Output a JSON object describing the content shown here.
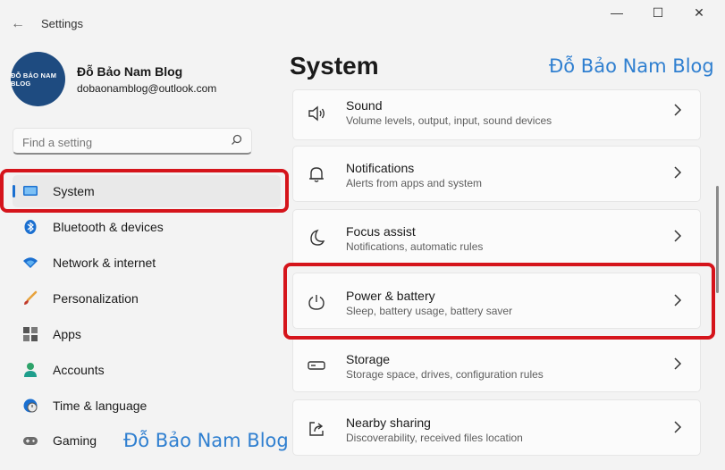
{
  "window": {
    "title": "Settings",
    "back_glyph": "←",
    "min_glyph": "—",
    "max_glyph": "☐",
    "close_glyph": "✕"
  },
  "profile": {
    "name": "Đỗ Bảo Nam Blog",
    "email": "dobaonamblog@outlook.com",
    "avatar_text": "ĐỖ BẢO NAM BLOG"
  },
  "search": {
    "placeholder": "Find a setting",
    "value": ""
  },
  "sidebar": {
    "items": [
      {
        "label": "System",
        "icon": "monitor-icon",
        "selected": true
      },
      {
        "label": "Bluetooth & devices",
        "icon": "bluetooth-icon",
        "selected": false
      },
      {
        "label": "Network & internet",
        "icon": "wifi-icon",
        "selected": false
      },
      {
        "label": "Personalization",
        "icon": "brush-icon",
        "selected": false
      },
      {
        "label": "Apps",
        "icon": "apps-icon",
        "selected": false
      },
      {
        "label": "Accounts",
        "icon": "person-icon",
        "selected": false
      },
      {
        "label": "Time & language",
        "icon": "globe-clock-icon",
        "selected": false
      },
      {
        "label": "Gaming",
        "icon": "gamepad-icon",
        "selected": false
      }
    ]
  },
  "main": {
    "title": "System",
    "cards": [
      {
        "title": "Sound",
        "desc": "Volume levels, output, input, sound devices",
        "icon": "speaker-icon"
      },
      {
        "title": "Notifications",
        "desc": "Alerts from apps and system",
        "icon": "bell-icon"
      },
      {
        "title": "Focus assist",
        "desc": "Notifications, automatic rules",
        "icon": "moon-icon"
      },
      {
        "title": "Power & battery",
        "desc": "Sleep, battery usage, battery saver",
        "icon": "power-icon"
      },
      {
        "title": "Storage",
        "desc": "Storage space, drives, configuration rules",
        "icon": "storage-drive-icon"
      },
      {
        "title": "Nearby sharing",
        "desc": "Discoverability, received files location",
        "icon": "share-icon"
      }
    ]
  },
  "watermark": {
    "text": "Đỗ Bảo Nam Blog"
  },
  "colors": {
    "accent": "#1a6fd0",
    "highlight_red": "#d5141b",
    "watermark_blue": "#2f7fd0"
  }
}
